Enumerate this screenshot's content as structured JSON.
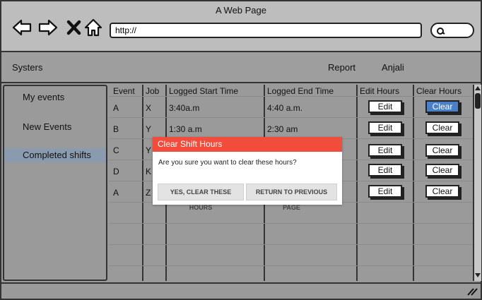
{
  "window": {
    "title": "A Web Page"
  },
  "browser": {
    "url": "http://"
  },
  "icons": [
    "back-arrow-icon",
    "forward-arrow-icon",
    "close-x-icon",
    "home-icon",
    "search-icon"
  ],
  "app": {
    "brand": "Systers",
    "nav": [
      {
        "label": "Report"
      },
      {
        "label": "Anjali"
      }
    ]
  },
  "sidebar": {
    "items": [
      {
        "label": "My events",
        "active": false
      },
      {
        "label": "New Events",
        "active": false
      },
      {
        "label": "Completed shifts",
        "active": true
      }
    ]
  },
  "table": {
    "headers": [
      "Event",
      "Job",
      "Logged Start Time",
      "Logged End Time",
      "Edit Hours",
      "Clear Hours"
    ],
    "rows": [
      {
        "event": "A",
        "job": "X",
        "start": "3:40a.m",
        "end": "4:40 a.m.",
        "edit": "Edit",
        "clear": "Clear"
      },
      {
        "event": "B",
        "job": "Y",
        "start": "1:30 a.m",
        "end": "2:30 am",
        "edit": "Edit",
        "clear": "Clear"
      },
      {
        "event": "C",
        "job": "Y",
        "start": "",
        "end": "",
        "edit": "Edit",
        "clear": "Clear"
      },
      {
        "event": "D",
        "job": "K",
        "start": "",
        "end": "",
        "edit": "Edit",
        "clear": "Clear"
      },
      {
        "event": "A",
        "job": "Z",
        "start": "",
        "end": "",
        "edit": "Edit",
        "clear": "Clear"
      }
    ],
    "selected_clear_row": 0
  },
  "modal": {
    "title": "Clear Shift Hours",
    "message": "Are you sure you want to clear these hours?",
    "confirm_label": "YES, CLEAR THESE HOURS",
    "cancel_label": "RETURN TO PREVIOUS PAGE"
  },
  "colors": {
    "modal_header": "#f14c3c",
    "selected_button": "#4a80c8",
    "active_sidebar": "#8a9bb0"
  }
}
